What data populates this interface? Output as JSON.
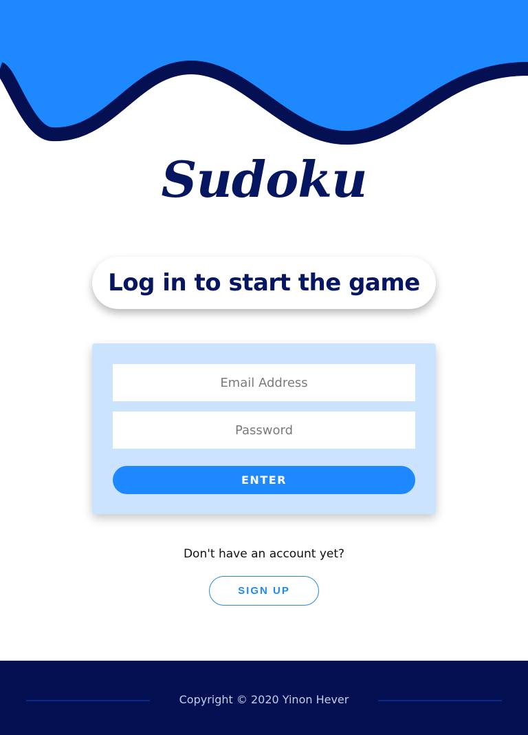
{
  "header": {
    "logo": "Sudoku",
    "colors": {
      "wave_fill": "#1e88ff",
      "wave_stroke": "#041052"
    }
  },
  "headline": "Log in to start the game",
  "login_form": {
    "email_placeholder": "Email Address",
    "password_placeholder": "Password",
    "enter_label": "ENTER"
  },
  "signup": {
    "prompt": "Don't have an account yet?",
    "button_label": "SIGN UP"
  },
  "footer": {
    "copyright": "Copyright © 2020 Yinon Hever"
  }
}
